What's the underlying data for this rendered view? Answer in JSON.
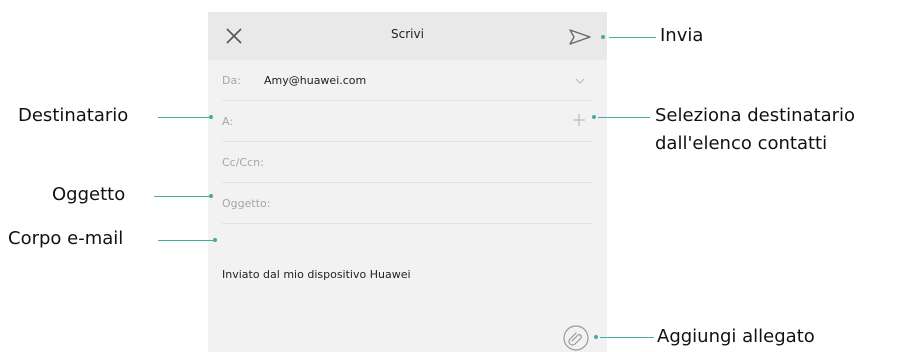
{
  "header": {
    "title": "Scrivi"
  },
  "form": {
    "from_label": "Da:",
    "from_value": "Amy@huawei.com",
    "to_label": "A:",
    "cc_label": "Cc/Ccn:",
    "subject_label": "Oggetto:"
  },
  "body": {
    "signature": "Inviato dal mio dispositivo Huawei"
  },
  "callouts": {
    "send": "Invia",
    "recipient": "Destinatario",
    "select_contacts_line1": "Seleziona destinatario",
    "select_contacts_line2": "dall'elenco contatti",
    "subject": "Oggetto",
    "body": "Corpo e-mail",
    "attachment": "Aggiungi allegato"
  },
  "icons": {
    "close": "close-icon",
    "send": "send-icon",
    "expand": "chevron-down-icon",
    "add_contact": "plus-icon",
    "attach": "paperclip-icon"
  },
  "colors": {
    "accent": "#4aa9a3",
    "panel": "#f2f2f2",
    "topbar": "#e9e9e9",
    "muted_text": "#a6a6a6"
  }
}
